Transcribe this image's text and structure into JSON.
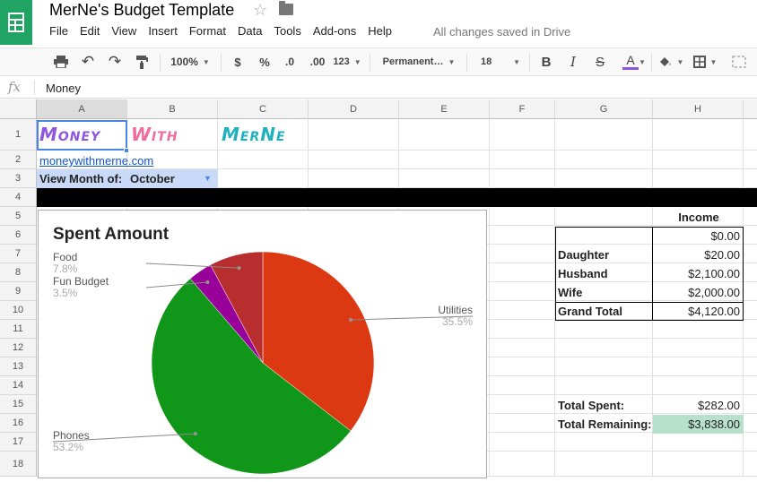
{
  "app": {
    "doc_title": "MerNe's Budget Template",
    "menu": [
      "File",
      "Edit",
      "View",
      "Insert",
      "Format",
      "Data",
      "Tools",
      "Add-ons",
      "Help"
    ],
    "saved_status": "All changes saved in Drive"
  },
  "toolbar": {
    "zoom": "100%",
    "currency": "$",
    "percent": "%",
    "dec_less": ".0",
    "dec_more": ".00",
    "more_formats": "123",
    "font": "Permanent…",
    "font_size": "18",
    "bold": "B",
    "italic": "I",
    "strike": "S",
    "text_color": "A",
    "text_color_hex": "#8e56dd"
  },
  "formula_bar": {
    "fx": "fx",
    "value": "Money"
  },
  "columns": [
    "A",
    "B",
    "C",
    "D",
    "E",
    "F",
    "G",
    "H"
  ],
  "rows": [
    "1",
    "2",
    "3",
    "4",
    "5",
    "6",
    "7",
    "8",
    "9",
    "10",
    "11",
    "12",
    "13",
    "14",
    "15",
    "16",
    "17",
    "18"
  ],
  "sheet": {
    "title_words": [
      {
        "text": "Money",
        "color": "#8e56dd"
      },
      {
        "text": "With",
        "color": "#ee6b9b"
      },
      {
        "text": "MerNe",
        "color": "#1fb1c0"
      }
    ],
    "link": "moneywithmerne.com",
    "view_month_label": "View Month of:",
    "view_month_value": "October",
    "income": {
      "header": "Income",
      "rows": [
        {
          "label": "",
          "value": "$0.00"
        },
        {
          "label": "Daughter",
          "value": "$20.00"
        },
        {
          "label": "Husband",
          "value": "$2,100.00"
        },
        {
          "label": "Wife",
          "value": "$2,000.00"
        }
      ],
      "total_label": "Grand Total",
      "total_value": "$4,120.00"
    },
    "total_spent_label": "Total Spent:",
    "total_spent_value": "$282.00",
    "total_remaining_label": "Total Remaining:",
    "total_remaining_value": "$3,838.00",
    "remaining_bg": "#b7e1cd"
  },
  "chart_data": {
    "type": "pie",
    "title": "Spent Amount",
    "slices": [
      {
        "label": "Utilities",
        "percent": 35.5,
        "color": "#dc3912"
      },
      {
        "label": "Phones",
        "percent": 53.2,
        "color": "#109618"
      },
      {
        "label": "Fun Budget",
        "percent": 3.5,
        "color": "#990099"
      },
      {
        "label": "Food",
        "percent": 7.8,
        "color": "#b82e2e"
      }
    ],
    "value_labels": [
      "35.5%",
      "53.2%",
      "3.5%",
      "7.8%"
    ]
  }
}
